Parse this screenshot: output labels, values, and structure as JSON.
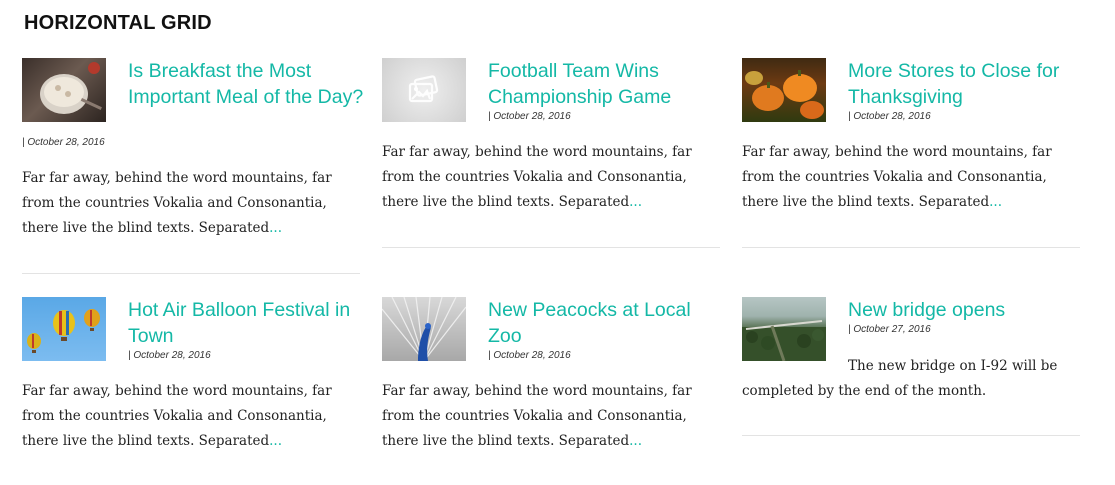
{
  "section": {
    "title": "HORIZONTAL GRID"
  },
  "colors": {
    "accent": "#14b8a6",
    "text": "#222222",
    "divider": "#e3e3e3"
  },
  "posts": [
    {
      "title": "Is Breakfast the Most Important Meal of the Day?",
      "date": "| October 28, 2016",
      "excerpt": "Far far away, behind the word mountains, far from the countries Vokalia and Consonantia, there live the blind texts. Separated",
      "more": "...",
      "image": "breakfast-bowl-photo"
    },
    {
      "title": "Football Team Wins Championship Game",
      "date": "| October 28, 2016",
      "excerpt": "Far far away, behind the word mountains, far from the countries Vokalia and Consonantia, there live the blind texts. Separated",
      "more": "...",
      "image": "image-placeholder-icon"
    },
    {
      "title": "More Stores to Close for Thanksgiving",
      "date": "| October 28, 2016",
      "excerpt": "Far far away, behind the word mountains, far from the countries Vokalia and Consonantia, there live the blind texts. Separated",
      "more": "...",
      "image": "pumpkins-photo"
    },
    {
      "title": "Hot Air Balloon Festival in Town",
      "date": "| October 28, 2016",
      "excerpt": "Far far away, behind the word mountains, far from the countries Vokalia and Consonantia, there live the blind texts. Separated",
      "more": "...",
      "image": "hot-air-balloons-photo"
    },
    {
      "title": "New Peacocks at Local Zoo",
      "date": "| October 28, 2016",
      "excerpt": "Far far away, behind the word mountains, far from the countries Vokalia and Consonantia, there live the blind texts. Separated",
      "more": "...",
      "image": "peacock-photo"
    },
    {
      "title": "New bridge opens",
      "date": "| October 27, 2016",
      "excerpt": "The new bridge on I-92 will be completed by the end of the month.",
      "more": "",
      "image": "bridge-aerial-photo"
    }
  ]
}
